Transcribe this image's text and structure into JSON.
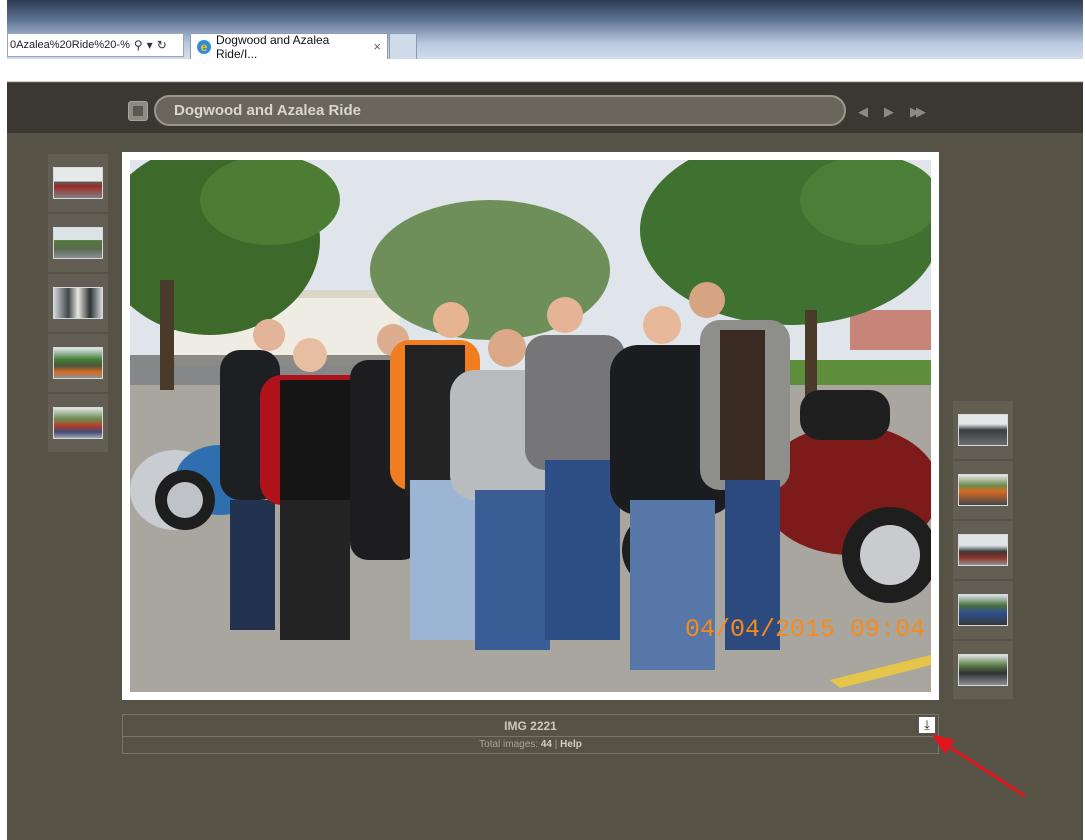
{
  "browser": {
    "address_text": "0Azalea%20Ride%20-%",
    "tab_title": "Dogwood and Azalea Ride/I...",
    "tab_close": "×"
  },
  "gallery": {
    "title": "Dogwood and Azalea Ride",
    "nav": {
      "prev": "◀",
      "next": "▶",
      "slideshow": "▶▶"
    }
  },
  "photo": {
    "date_stamp": "04/04/2015 09:04",
    "image_name": "IMG 2221",
    "total_label": "Total images:",
    "total_count": "44",
    "separator": "|",
    "help_label": "Help"
  },
  "colors": {
    "accent_arrow": "#e0151b",
    "date_stamp": "#f58a1f",
    "page_bg": "#575246"
  }
}
